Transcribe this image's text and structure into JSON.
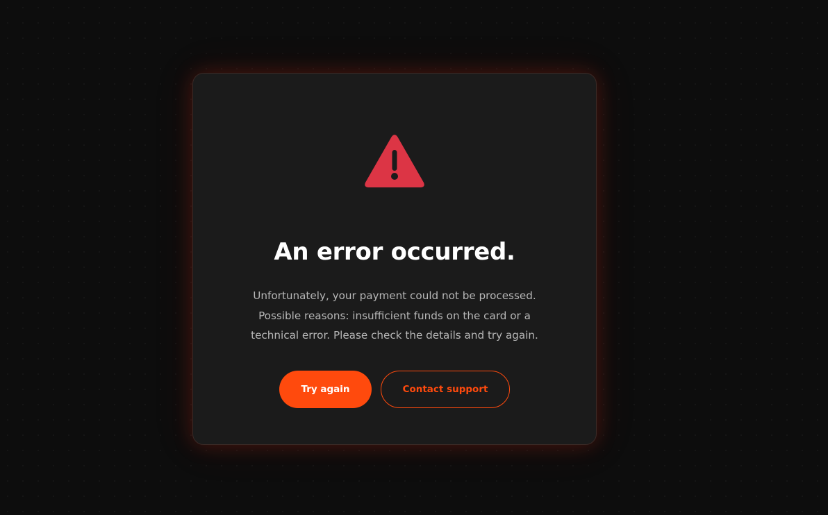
{
  "dialog": {
    "icon": "warning-icon",
    "title": "An error occurred.",
    "message": "Unfortunately, your payment could not be processed. Possible reasons: insufficient funds on the card or a technical error. Please check the details and try again.",
    "primary_button": "Try again",
    "secondary_button": "Contact support"
  },
  "colors": {
    "background": "#0d0d0d",
    "card": "#1b1b1b",
    "accent": "#ff4a0d",
    "warning": "#dc3545",
    "title": "#ffffff",
    "message": "#b7b7b7"
  }
}
